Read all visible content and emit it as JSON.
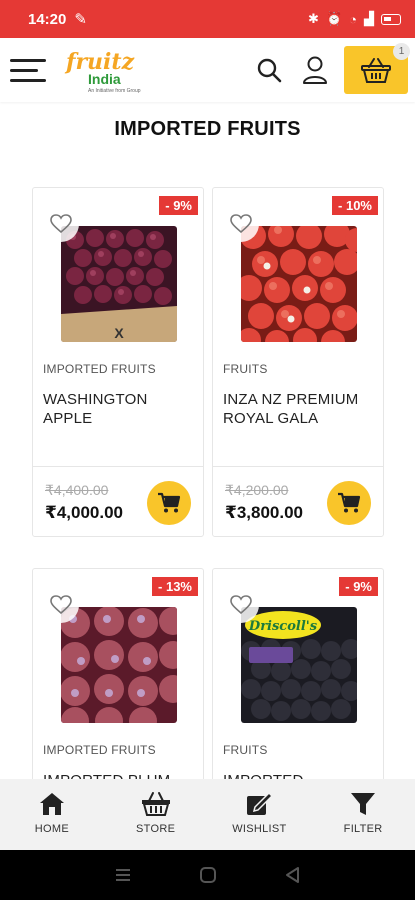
{
  "status_bar": {
    "time": "14:20",
    "battery": "5"
  },
  "header": {
    "logo_line1": "fruitz",
    "logo_line2": "India",
    "logo_tagline": "An Initiative from Group",
    "cart_count": "1"
  },
  "page_title": "IMPORTED FRUITS",
  "colors": {
    "accent_red": "#e53935",
    "accent_yellow": "#f9c52a"
  },
  "products": [
    {
      "discount": "- 9%",
      "category": "IMPORTED FRUITS",
      "name": "WASHINGTON APPLE",
      "old_price": "₹4,400.00",
      "price": "₹4,000.00"
    },
    {
      "discount": "- 10%",
      "category": "FRUITS",
      "name": "INZA NZ PREMIUM ROYAL GALA",
      "old_price": "₹4,200.00",
      "price": "₹3,800.00"
    },
    {
      "discount": "- 13%",
      "category": "IMPORTED FRUITS",
      "name": "IMPORTED PLUM",
      "old_price": "",
      "price": ""
    },
    {
      "discount": "- 9%",
      "category": "FRUITS",
      "name": "IMPORTED",
      "old_price": "",
      "price": "",
      "brand_label": "Driscoll's"
    }
  ],
  "bottom_nav": [
    {
      "label": "HOME",
      "icon": "home-icon"
    },
    {
      "label": "STORE",
      "icon": "store-basket-icon"
    },
    {
      "label": "WISHLIST",
      "icon": "wishlist-icon"
    },
    {
      "label": "FILTER",
      "icon": "filter-icon"
    }
  ]
}
